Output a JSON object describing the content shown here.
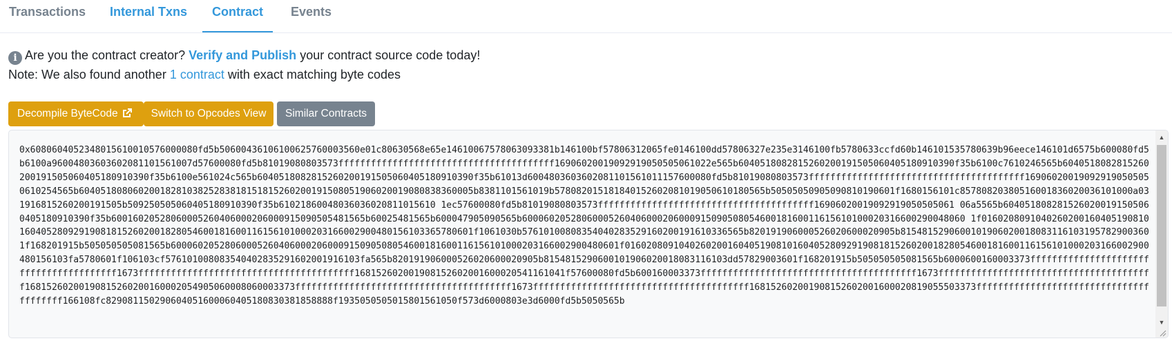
{
  "tabs": [
    {
      "label": "Transactions",
      "active": false
    },
    {
      "label": "Internal Txns",
      "active": false
    },
    {
      "label": "Contract",
      "active": true
    },
    {
      "label": "Events",
      "active": false
    }
  ],
  "notice": {
    "icon": "info-circle-icon",
    "prefix": "Are you the contract creator?",
    "link": "Verify and Publish",
    "suffix": "your contract source code today!"
  },
  "note": {
    "prefix": "Note: We also found another",
    "link": "1 contract",
    "suffix": "with exact matching byte codes"
  },
  "buttons": {
    "decompile": "Decompile ByteCode",
    "opcodes": "Switch to Opcodes View",
    "similar": "Similar Contracts"
  },
  "colors": {
    "accent": "#3498db",
    "warning": "#dea00f",
    "secondary": "#77838f"
  },
  "bytecode": "0x6080604052348015610010576000080fd5b50600436106100625760003560e01c80630568e65e14610067578063093381b146100bf57806312065fe0146100dd57806327e235e3146100fb5780633ccfd60b146101535780639b96eece146101d6575b600080fd5b6100a96004803603602081101561007d57600080fd5b81019080803573ffffffffffffffffffffffffffffffffffffffff16906020019092919050505061022e565b6040518082815260200191505060405180910390f35b6100c7610246565b6040518082815260200191505060405180910390f35b6100e561024c565b6040518082815260200191505060405180910390f35b61013d6004803603602081101561011157600080fd5b81019080803573ffffffffffffffffffffffffffffffffffffffff169060200190929190505050610254565b6040518080602001828103825283818151815260200191508051906020019080838360005b8381101561019b578082015181840152602081019050610180565b50505050905090810190601f1680156101c85780820380516001836020036101000a031916815260200191505b509250505060405180910390f35b61021860048036036020811015610 1ec57600080fd5b81019080803573ffffffffffffffffffffffffffffffffffffffff16906020019092919050505061 06a5565b6040518082815260200191505060405180910390f35b60016020528060005260406000206000915090505481565b60025481565b600047905090565b6000602052806000526040600020600091509050805460018160011615610100020316600290048060 1f0160208091040260200160405190810160405280929190818152602001828054600181600116156101000203166002900480156103365780601f1061030b57610100808354040283529160200191610336565b820191906000526020600020905b81548152906001019060200180831161031957829003601f168201915b505050505081565b60006020528060005260406000206000915090508054600181600116156101000203166002900480601f0160208091040260200160405190810160405280929190818152602001828054600181600116156101000203166002900480156103fa5780601f106103cf576101008083540402835291602001916103fa565b820191906000526020600020905b8154815290600101906020018083116103dd57829003601f168201915b505050505081565b6000600160003373ffffffffffffffffffffffffffffffffffffffff1673ffffffffffffffffffffffffffffffffffffffff168152602001908152602001600020541161041f57600080fd5b600160003373ffffffffffffffffffffffffffffffffffffffff1673ffffffffffffffffffffffffffffffffffffffff16815260200190815260200160002054905060008060003373ffffffffffffffffffffffffffffffffffffffff1673ffffffffffffffffffffffffffffffffffffffff168152602001908152602001600020819055503373ffffffffffffffffffffffffffffffffffffffff166108fc829081150290604051600060405180830381858888f1935050505015801561050f573d6000803e3d6000fd5b5050565b"
}
